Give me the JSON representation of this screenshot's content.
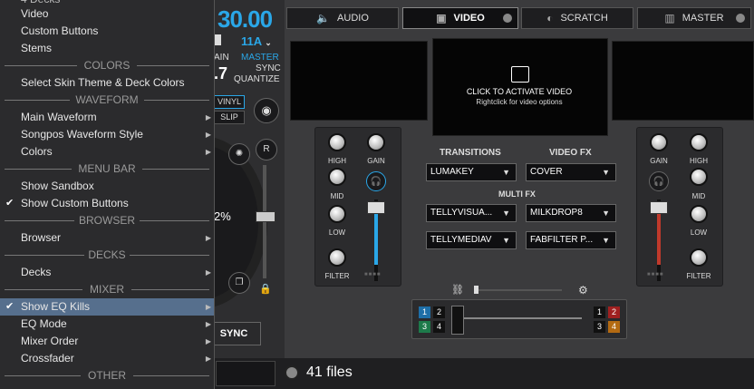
{
  "deck": {
    "bpm": "30.00",
    "key": "11A",
    "pitch_label": "AIN",
    "pitch_value": ".7",
    "master_label": "MASTER",
    "sync_label": "SYNC",
    "quantize_label": "QUANTIZE",
    "vinyl_label": "VINYL",
    "slip_label": "SLIP",
    "platter_pct": "2%",
    "r_label": "R",
    "sync_button": "SYNC"
  },
  "tabs": [
    {
      "label": "AUDIO",
      "icon": "speaker-icon"
    },
    {
      "label": "VIDEO",
      "icon": "video-icon"
    },
    {
      "label": "SCRATCH",
      "icon": "scratch-icon"
    },
    {
      "label": "MASTER",
      "icon": "master-icon"
    }
  ],
  "video": {
    "click_text": "CLICK TO ACTIVATE VIDEO",
    "right_text": "Rightclick for video options"
  },
  "eq_left": {
    "high": "HIGH",
    "gain": "GAIN",
    "mid": "MID",
    "low": "LOW",
    "filter": "FILTER"
  },
  "eq_right": {
    "gain": "GAIN",
    "high": "HIGH",
    "mid": "MID",
    "low": "LOW",
    "filter": "FILTER"
  },
  "center": {
    "transitions_label": "TRANSITIONS",
    "videofx_label": "VIDEO FX",
    "multifx_label": "MULTI FX",
    "transition_value": "LUMAKEY",
    "videofx_value": "COVER",
    "multifx": [
      "TELLYVISUA...",
      "MILKDROP8",
      "TELLYMEDIAV",
      "FABFILTER P..."
    ]
  },
  "crossfader": {
    "left_chips": [
      "1",
      "2",
      "3",
      "4"
    ],
    "right_chips": [
      "1",
      "2",
      "3",
      "4"
    ]
  },
  "browser": {
    "files": "41 files"
  },
  "menu": {
    "top_items": [
      "Video",
      "Custom Buttons",
      "Stems"
    ],
    "sections": {
      "colors": "COLORS",
      "waveform": "WAVEFORM",
      "menubar": "MENU BAR",
      "browser": "BROWSER",
      "decks": "DECKS",
      "mixer": "MIXER",
      "other": "OTHER"
    },
    "select_skin": "Select Skin Theme & Deck Colors",
    "main_waveform": "Main Waveform",
    "songpos_waveform": "Songpos Waveform Style",
    "colors_item": "Colors",
    "show_sandbox": "Show Sandbox",
    "show_custom_buttons": "Show Custom Buttons",
    "browser_item": "Browser",
    "decks_item": "Decks",
    "show_eq_kills": "Show EQ Kills",
    "eq_mode": "EQ Mode",
    "mixer_order": "Mixer Order",
    "crossfader_item": "Crossfader"
  },
  "colors": {
    "accent": "#2aa7e8",
    "highlight": "#566f8d",
    "red": "#c0392b"
  }
}
